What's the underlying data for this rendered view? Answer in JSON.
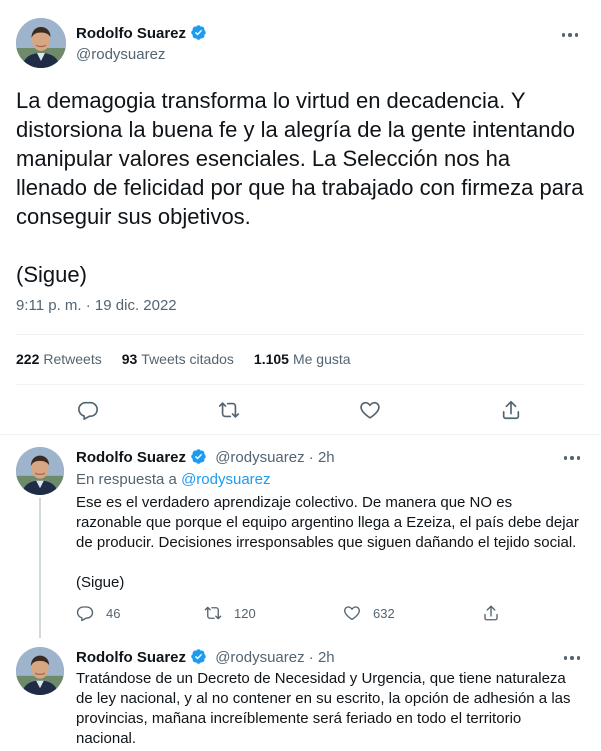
{
  "main_tweet": {
    "author_name": "Rodolfo Suarez",
    "author_handle": "@rodysuarez",
    "text": "La demagogia transforma lo virtud en decadencia. Y distorsiona la buena fe y la alegría de la gente intentando manipular valores esenciales. La Selección nos ha llenado de felicidad por que ha trabajado con firmeza para conseguir sus objetivos.\n\n(Sigue)",
    "timestamp": "9:11 p. m. · 19 dic. 2022",
    "stats": {
      "retweets_count": "222",
      "retweets_label": "Retweets",
      "quotes_count": "93",
      "quotes_label": "Tweets citados",
      "likes_count": "1.105",
      "likes_label": "Me gusta"
    }
  },
  "replies": [
    {
      "author_name": "Rodolfo Suarez",
      "author_handle": "@rodysuarez",
      "age": "· 2h",
      "in_reply_prefix": "En respuesta a",
      "in_reply_handle": "@rodysuarez",
      "text": "Ese es el verdadero aprendizaje colectivo. De manera que NO es razonable que porque el equipo argentino llega a Ezeiza, el país debe dejar de producir. Decisiones irresponsables que siguen dañando el tejido social.\n\n(Sigue)",
      "reply_count": "46",
      "retweet_count": "120",
      "like_count": "632"
    },
    {
      "author_name": "Rodolfo Suarez",
      "author_handle": "@rodysuarez",
      "age": "· 2h",
      "text": "Tratándose de un Decreto de Necesidad y Urgencia, que tiene naturaleza de ley nacional, y al no contener en su escrito, la opción de adhesión a las provincias, mañana increíblemente será feriado en todo el territorio nacional."
    }
  ],
  "colors": {
    "accent": "#1d9bf0",
    "text_primary": "#0f1419",
    "text_secondary": "#536471",
    "divider": "#eff3f4"
  },
  "icons": [
    "verified-badge-icon",
    "more-icon",
    "reply-icon",
    "retweet-icon",
    "like-icon",
    "share-icon"
  ]
}
